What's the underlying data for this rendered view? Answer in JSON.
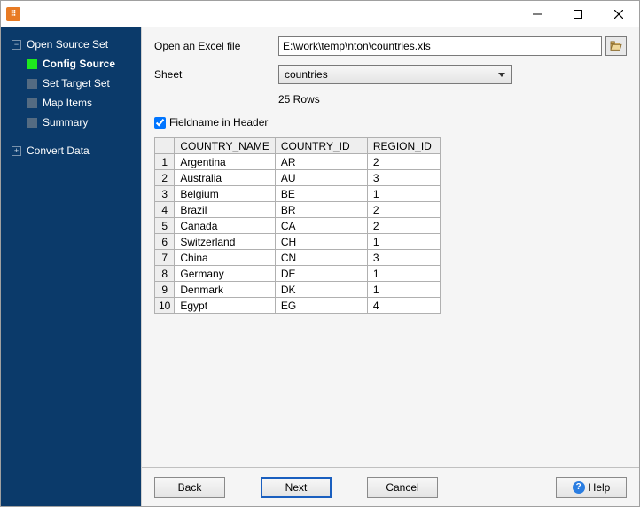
{
  "sidebar": {
    "items": [
      {
        "label": "Open Source Set",
        "type": "parent"
      },
      {
        "label": "Config Source",
        "type": "child",
        "active": true
      },
      {
        "label": "Set Target Set",
        "type": "child"
      },
      {
        "label": "Map Items",
        "type": "child"
      },
      {
        "label": "Summary",
        "type": "child"
      },
      {
        "label": "Convert Data",
        "type": "parent"
      }
    ]
  },
  "form": {
    "open_label": "Open an Excel file",
    "file_path": "E:\\work\\temp\\nton\\countries.xls",
    "sheet_label": "Sheet",
    "sheet_value": "countries",
    "rows_info": "25 Rows",
    "fieldname_label": "Fieldname in Header",
    "fieldname_checked": true
  },
  "table": {
    "headers": [
      "COUNTRY_NAME",
      "COUNTRY_ID",
      "REGION_ID"
    ],
    "rows": [
      [
        "Argentina",
        "AR",
        "2"
      ],
      [
        "Australia",
        "AU",
        "3"
      ],
      [
        "Belgium",
        "BE",
        "1"
      ],
      [
        "Brazil",
        "BR",
        "2"
      ],
      [
        "Canada",
        "CA",
        "2"
      ],
      [
        "Switzerland",
        "CH",
        "1"
      ],
      [
        "China",
        "CN",
        "3"
      ],
      [
        "Germany",
        "DE",
        "1"
      ],
      [
        "Denmark",
        "DK",
        "1"
      ],
      [
        "Egypt",
        "EG",
        "4"
      ]
    ]
  },
  "footer": {
    "back": "Back",
    "next": "Next",
    "cancel": "Cancel",
    "help": "Help"
  }
}
